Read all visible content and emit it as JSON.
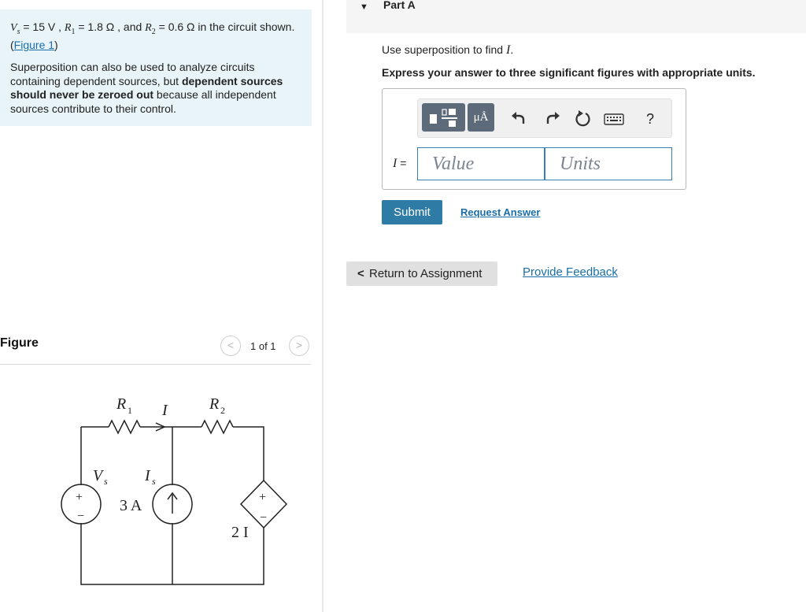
{
  "problem": {
    "vs_sym": "V",
    "vs_sub": "s",
    "vs_val": " = 15 V , ",
    "r1_sym": "R",
    "r1_sub": "1",
    "r1_val": " = 1.8 Ω , and ",
    "r2_sym": "R",
    "r2_sub": "2",
    "r2_val": " = 0.6 Ω in the circuit shown.(",
    "figure_link": "Figure 1",
    "close_paren": ")",
    "p2_a": "Superposition can also be used to analyze circuits containing dependent sources, but ",
    "p2_bold": "dependent sources should never be zeroed out",
    "p2_b": " because all independent sources contribute to their control."
  },
  "figure": {
    "title": "Figure",
    "pager_text": "1 of 1",
    "prev_icon": "chevron-left-icon",
    "next_icon": "chevron-right-icon",
    "labels": {
      "r1": "R",
      "r1_sub": "1",
      "r2": "R",
      "r2_sub": "2",
      "current": "I",
      "vs": "V",
      "vs_sub": "s",
      "is": "I",
      "is_sub": "s",
      "is_value": "3 A",
      "dep_value": "2 I",
      "plus": "+",
      "minus": "−"
    }
  },
  "part": {
    "title": "Part A",
    "instr_a": "Use superposition to find ",
    "instr_var": "I",
    "instr_b": ".",
    "instr2": "Express your answer to three significant figures with appropriate units."
  },
  "answer": {
    "var_label": "I",
    "equals": " =",
    "value_placeholder": "Value",
    "units_placeholder": "Units",
    "units_button": "μÅ"
  },
  "toolbar": {
    "templates_icon": "templates-icon",
    "undo_icon": "undo-icon",
    "redo_icon": "redo-icon",
    "reset_icon": "reset-icon",
    "keyboard_icon": "keyboard-icon",
    "help_label": "?"
  },
  "actions": {
    "submit": "Submit",
    "request_answer": "Request Answer",
    "return": "Return to Assignment",
    "feedback": "Provide Feedback"
  },
  "colors": {
    "problem_bg": "#e8f4f7",
    "link": "#1a6ea8",
    "submit_bg": "#2e7ba6",
    "toolbar_btn": "#5c6a7a"
  }
}
